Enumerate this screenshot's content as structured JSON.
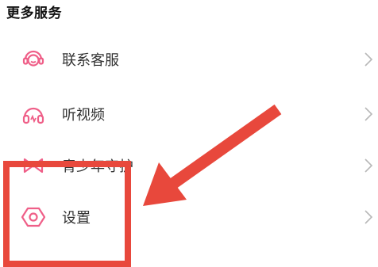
{
  "section": {
    "title": "更多服务"
  },
  "items": [
    {
      "label": "联系客服",
      "icon": "headset-icon"
    },
    {
      "label": "听视频",
      "icon": "headphones-icon"
    },
    {
      "label": "青少年守护",
      "icon": "bow-icon"
    },
    {
      "label": "设置",
      "icon": "settings-hexagon-icon"
    }
  ],
  "colors": {
    "accent": "#ef5f88",
    "annotation": "#e8483c",
    "chevron": "#b8b8b8"
  }
}
